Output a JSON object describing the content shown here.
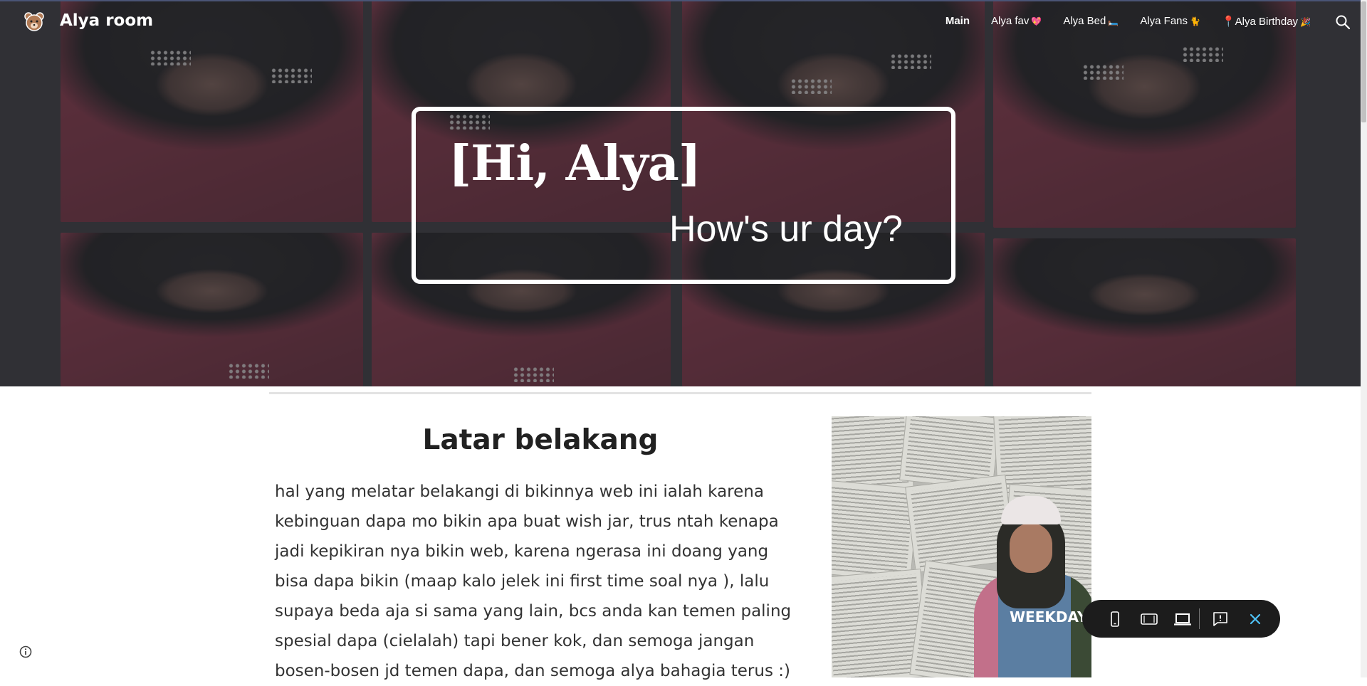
{
  "header": {
    "site_title": "Alya room",
    "logo_icon": "teddy-bear-icon",
    "nav": [
      {
        "label": "Main",
        "emoji": "",
        "active": true
      },
      {
        "label": "Alya fav",
        "emoji": "💖",
        "active": false
      },
      {
        "label": "Alya Bed",
        "emoji": "🛏️",
        "active": false
      },
      {
        "label": "Alya Fans",
        "emoji": "🐈",
        "active": false
      },
      {
        "label": "📍Alya Birthday",
        "emoji": "🎉",
        "active": false
      }
    ],
    "search_icon": "search-icon"
  },
  "hero": {
    "title": "[Hi, Alya]",
    "subtitle": "How's ur day?"
  },
  "content": {
    "heading": "Latar belakang",
    "paragraph": "hal yang melatar belakangi di bikinnya web ini ialah karena kebinguan dapa mo bikin apa buat wish jar, trus ntah kenapa jadi kepikiran nya bikin web, karena ngerasa ini doang yang bisa dapa bikin (maap kalo jelek ini first time soal nya ), lalu supaya beda aja si sama yang lain, bcs anda kan temen paling spesial dapa (cielalah) tapi bener kok, dan semoga jangan bosen-bosen jd temen dapa, dan semoga alya bahagia terus :)",
    "photo_shirt_text": "WEEKDAY"
  },
  "preview_toolbar": {
    "buttons": [
      "phone-preview-icon",
      "tablet-preview-icon",
      "laptop-preview-icon",
      "report-abuse-icon",
      "close-icon"
    ]
  },
  "colors": {
    "accent": "#1a73e8",
    "hero_overlay": "#2a2a2e",
    "text": "#333333"
  }
}
